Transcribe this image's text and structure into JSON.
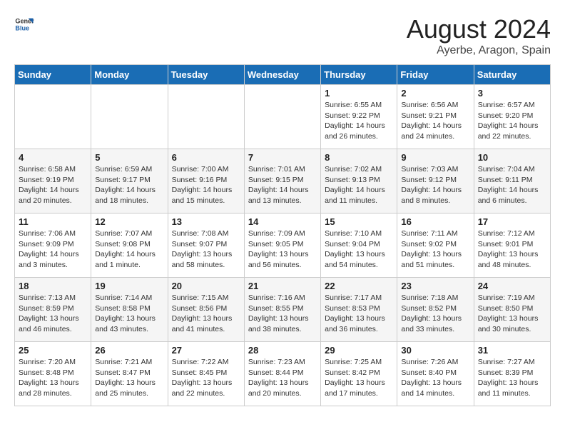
{
  "header": {
    "logo_general": "General",
    "logo_blue": "Blue",
    "month_year": "August 2024",
    "location": "Ayerbe, Aragon, Spain"
  },
  "weekdays": [
    "Sunday",
    "Monday",
    "Tuesday",
    "Wednesday",
    "Thursday",
    "Friday",
    "Saturday"
  ],
  "weeks": [
    [
      {
        "day": "",
        "info": ""
      },
      {
        "day": "",
        "info": ""
      },
      {
        "day": "",
        "info": ""
      },
      {
        "day": "",
        "info": ""
      },
      {
        "day": "1",
        "info": "Sunrise: 6:55 AM\nSunset: 9:22 PM\nDaylight: 14 hours\nand 26 minutes."
      },
      {
        "day": "2",
        "info": "Sunrise: 6:56 AM\nSunset: 9:21 PM\nDaylight: 14 hours\nand 24 minutes."
      },
      {
        "day": "3",
        "info": "Sunrise: 6:57 AM\nSunset: 9:20 PM\nDaylight: 14 hours\nand 22 minutes."
      }
    ],
    [
      {
        "day": "4",
        "info": "Sunrise: 6:58 AM\nSunset: 9:19 PM\nDaylight: 14 hours\nand 20 minutes."
      },
      {
        "day": "5",
        "info": "Sunrise: 6:59 AM\nSunset: 9:17 PM\nDaylight: 14 hours\nand 18 minutes."
      },
      {
        "day": "6",
        "info": "Sunrise: 7:00 AM\nSunset: 9:16 PM\nDaylight: 14 hours\nand 15 minutes."
      },
      {
        "day": "7",
        "info": "Sunrise: 7:01 AM\nSunset: 9:15 PM\nDaylight: 14 hours\nand 13 minutes."
      },
      {
        "day": "8",
        "info": "Sunrise: 7:02 AM\nSunset: 9:13 PM\nDaylight: 14 hours\nand 11 minutes."
      },
      {
        "day": "9",
        "info": "Sunrise: 7:03 AM\nSunset: 9:12 PM\nDaylight: 14 hours\nand 8 minutes."
      },
      {
        "day": "10",
        "info": "Sunrise: 7:04 AM\nSunset: 9:11 PM\nDaylight: 14 hours\nand 6 minutes."
      }
    ],
    [
      {
        "day": "11",
        "info": "Sunrise: 7:06 AM\nSunset: 9:09 PM\nDaylight: 14 hours\nand 3 minutes."
      },
      {
        "day": "12",
        "info": "Sunrise: 7:07 AM\nSunset: 9:08 PM\nDaylight: 14 hours\nand 1 minute."
      },
      {
        "day": "13",
        "info": "Sunrise: 7:08 AM\nSunset: 9:07 PM\nDaylight: 13 hours\nand 58 minutes."
      },
      {
        "day": "14",
        "info": "Sunrise: 7:09 AM\nSunset: 9:05 PM\nDaylight: 13 hours\nand 56 minutes."
      },
      {
        "day": "15",
        "info": "Sunrise: 7:10 AM\nSunset: 9:04 PM\nDaylight: 13 hours\nand 54 minutes."
      },
      {
        "day": "16",
        "info": "Sunrise: 7:11 AM\nSunset: 9:02 PM\nDaylight: 13 hours\nand 51 minutes."
      },
      {
        "day": "17",
        "info": "Sunrise: 7:12 AM\nSunset: 9:01 PM\nDaylight: 13 hours\nand 48 minutes."
      }
    ],
    [
      {
        "day": "18",
        "info": "Sunrise: 7:13 AM\nSunset: 8:59 PM\nDaylight: 13 hours\nand 46 minutes."
      },
      {
        "day": "19",
        "info": "Sunrise: 7:14 AM\nSunset: 8:58 PM\nDaylight: 13 hours\nand 43 minutes."
      },
      {
        "day": "20",
        "info": "Sunrise: 7:15 AM\nSunset: 8:56 PM\nDaylight: 13 hours\nand 41 minutes."
      },
      {
        "day": "21",
        "info": "Sunrise: 7:16 AM\nSunset: 8:55 PM\nDaylight: 13 hours\nand 38 minutes."
      },
      {
        "day": "22",
        "info": "Sunrise: 7:17 AM\nSunset: 8:53 PM\nDaylight: 13 hours\nand 36 minutes."
      },
      {
        "day": "23",
        "info": "Sunrise: 7:18 AM\nSunset: 8:52 PM\nDaylight: 13 hours\nand 33 minutes."
      },
      {
        "day": "24",
        "info": "Sunrise: 7:19 AM\nSunset: 8:50 PM\nDaylight: 13 hours\nand 30 minutes."
      }
    ],
    [
      {
        "day": "25",
        "info": "Sunrise: 7:20 AM\nSunset: 8:48 PM\nDaylight: 13 hours\nand 28 minutes."
      },
      {
        "day": "26",
        "info": "Sunrise: 7:21 AM\nSunset: 8:47 PM\nDaylight: 13 hours\nand 25 minutes."
      },
      {
        "day": "27",
        "info": "Sunrise: 7:22 AM\nSunset: 8:45 PM\nDaylight: 13 hours\nand 22 minutes."
      },
      {
        "day": "28",
        "info": "Sunrise: 7:23 AM\nSunset: 8:44 PM\nDaylight: 13 hours\nand 20 minutes."
      },
      {
        "day": "29",
        "info": "Sunrise: 7:25 AM\nSunset: 8:42 PM\nDaylight: 13 hours\nand 17 minutes."
      },
      {
        "day": "30",
        "info": "Sunrise: 7:26 AM\nSunset: 8:40 PM\nDaylight: 13 hours\nand 14 minutes."
      },
      {
        "day": "31",
        "info": "Sunrise: 7:27 AM\nSunset: 8:39 PM\nDaylight: 13 hours\nand 11 minutes."
      }
    ]
  ]
}
